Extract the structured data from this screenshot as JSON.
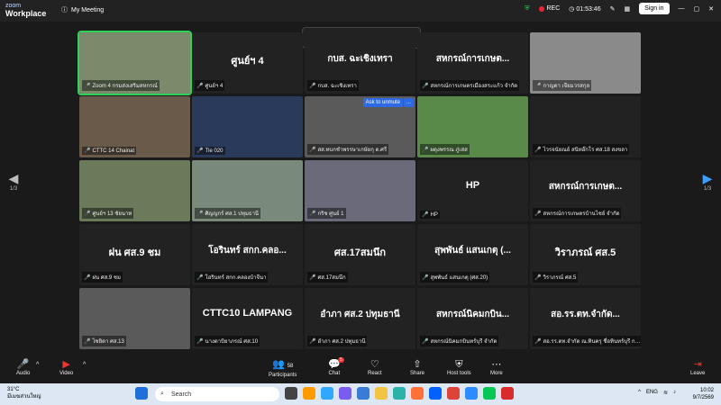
{
  "titlebar": {
    "brand_top": "zoom",
    "brand_bottom": "Workplace",
    "meeting_title": "My Meeting",
    "rec": "REC",
    "timer": "01:53:46",
    "signin": "Sign in"
  },
  "talking": "Zoom 4 กรมส่งเสริมสหกรณ์ is talking...",
  "tiles": [
    {
      "big": "",
      "label": "Zoom 4 กรมส่งเสริมสหกรณ์",
      "video": true
    },
    {
      "big": "ศูนย์ฯ 4",
      "label": "ศูนย์ฯ 4",
      "video": false
    },
    {
      "big": "กบส. ฉะเชิงเทรา",
      "label": "กบส. ฉะเชิงเทรา",
      "video": false
    },
    {
      "big": "สหกรณ์การเกษต...",
      "label": "สหกรณ์การเกษตรเมืองสระแก้ว จำกัด",
      "video": false
    },
    {
      "big": "",
      "label": "กาญดา เจียมวรสกุล",
      "video": true
    },
    {
      "big": "",
      "label": "CTTC 14 Chainat",
      "video": true
    },
    {
      "big": "",
      "label": "Tle 020",
      "video": true
    },
    {
      "big": "",
      "label": "สส.ทบกชำพรรษาเกษัยกุ ต.ศรี",
      "video": true
    },
    {
      "big": "",
      "label": "ผดุงพรรณ ภู่เสส",
      "video": true
    },
    {
      "big": "",
      "label": "ไวรจนัยณย์ สนิทอ๊กโร ศส.18 สงขลา",
      "video": false
    },
    {
      "big": "",
      "label": "ศูนย์ฯ 13 ชัยนาท",
      "video": true
    },
    {
      "big": "",
      "label": "ศิญญกร์ ศส.1 ปทุมธานี",
      "video": true
    },
    {
      "big": "",
      "label": "กริช ศูนย์ 1",
      "video": true
    },
    {
      "big": "HP",
      "label": "HP",
      "video": false
    },
    {
      "big": "สหกรณ์การเกษต...",
      "label": "สหกรณ์การเกษตรบ้านไชย์ จำกัด",
      "video": false
    },
    {
      "big": "ฝน ศส.9 ชม",
      "label": "ฝน ศส.9 ชม",
      "video": false
    },
    {
      "big": "โอรินทร์ สกก.คลอ...",
      "label": "โอรินทร์ สกก.คลองบ้าจีนา",
      "video": false
    },
    {
      "big": "ศส.17สมนึก",
      "label": "ศส.17สมนึก",
      "video": false
    },
    {
      "big": "สุพพันธ์ แสนเกตุ (...",
      "label": "สุพพันธ์ แสนเกตุ (ศส.20)",
      "video": false
    },
    {
      "big": "วิราภรณ์ ศส.5",
      "label": "วิราภรณ์ ศส.5",
      "video": false
    },
    {
      "big": "",
      "label": "ไซยิดา ศส.13",
      "video": true
    },
    {
      "big": "CTTC10 LAMPANG",
      "label": "นางดาบิยาภรณ์ ศส.10",
      "video": false
    },
    {
      "big": "อำภา ศส.2 ปทุมธานี",
      "label": "อำภา ศส.2 ปทุมธานี",
      "video": false
    },
    {
      "big": "สหกรณ์นิคมกบิน...",
      "label": "สหกรณ์นิคมกบินทร์บุรี จำกัด",
      "video": false
    },
    {
      "big": "สอ.รร.ตท.จำกัด...",
      "label": "สอ.รร.ตท.จำกัด ณ.ทินครุ ชื่อทินทร์บุรี กรร...",
      "video": false
    }
  ],
  "ask_unmute": "Ask to unmute",
  "ask_more": "...",
  "page_left": "1/3",
  "page_right": "1/3",
  "toolbar": {
    "audio": "Audio",
    "video": "Video",
    "participants": "Participants",
    "participants_count": "58",
    "chat": "Chat",
    "chat_badge": "5",
    "react": "React",
    "share": "Share",
    "host_tools": "Host tools",
    "more": "More",
    "leave": "Leave"
  },
  "taskbar": {
    "temp": "31°C",
    "weather": "มีเมฆส่วนใหญ่",
    "search": "Search",
    "lang": "ENG",
    "time": "10:02",
    "date": "9/7/2569"
  },
  "colors": {
    "active_speaker": "#2ed15a",
    "mic_muted": "#e33",
    "accent": "#2d6ae3"
  }
}
